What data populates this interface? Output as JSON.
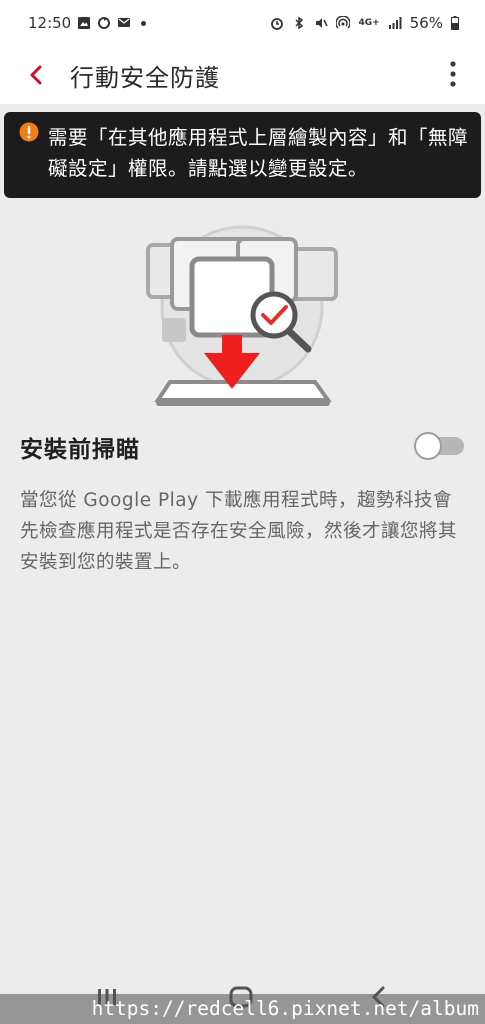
{
  "status_bar": {
    "time": "12:50",
    "battery_percent": "56%",
    "network": "4G+"
  },
  "app_bar": {
    "title": "行動安全防護"
  },
  "banner": {
    "text": "需要「在其他應用程式上層繪製內容」和「無障礙設定」權限。請點選以變更設定。"
  },
  "setting": {
    "title": "安裝前掃瞄",
    "enabled": false,
    "description": "當您從 Google Play 下載應用程式時，趨勢科技會先檢查應用程式是否存在安全風險，然後才讓您將其安裝到您的裝置上。"
  },
  "watermark": {
    "text": "https://redcell6.pixnet.net/album"
  },
  "colors": {
    "accent": "#c8102e",
    "banner_bg": "#1c1c1c",
    "warning_icon": "#f07c1a",
    "page_bg": "#ececec"
  }
}
